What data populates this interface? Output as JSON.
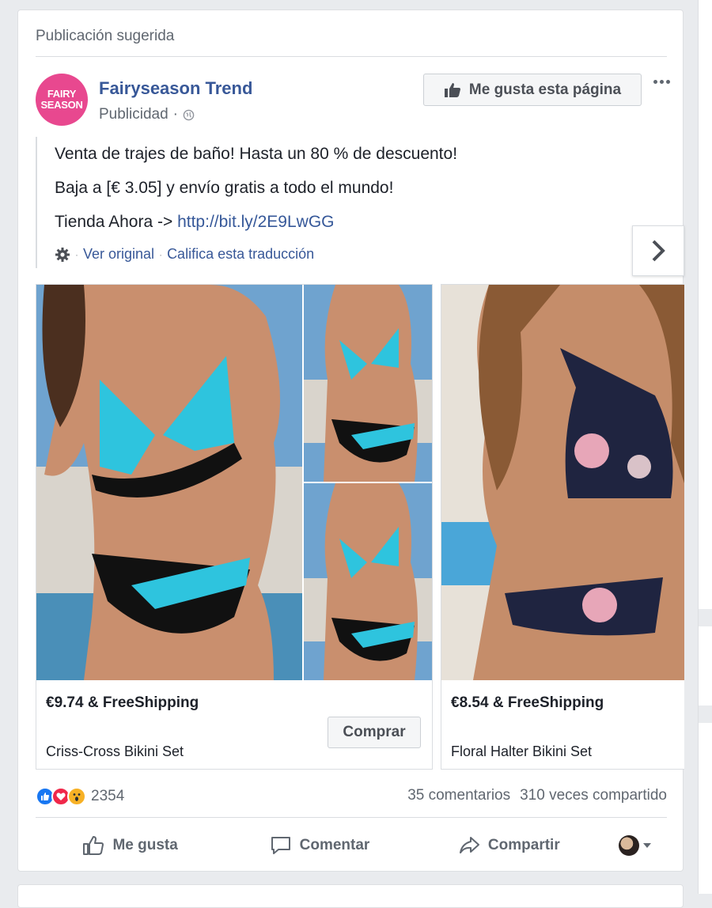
{
  "post": {
    "suggested_label": "Publicación sugerida",
    "page_name": "Fairyseason Trend",
    "avatar_text_line1": "FAIRY",
    "avatar_text_line2": "SEASON",
    "sponsored_label": "Publicidad",
    "separator": "·",
    "like_page_label": "Me gusta esta página",
    "text_line1": "Venta de trajes de baño! Hasta un 80 % de descuento!",
    "text_line2": "Baja a [€ 3.05] y envío gratis a todo el mundo!",
    "text_line3_prefix": "Tienda Ahora -> ",
    "text_line3_link": "http://bit.ly/2E9LwGG",
    "see_original": "Ver original",
    "rate_translation": "Califica esta traducción",
    "dot": "·"
  },
  "carousel": {
    "items": [
      {
        "price": "€9.74 & FreeShipping",
        "name": "Criss-Cross Bikini Set",
        "button": "Comprar"
      },
      {
        "price": "€8.54 & FreeShipping",
        "name": "Floral Halter Bikini Set"
      }
    ]
  },
  "engagement": {
    "reaction_count": "2354",
    "comments": "35 comentarios",
    "shares": "310 veces compartido"
  },
  "actions": {
    "like": "Me gusta",
    "comment": "Comentar",
    "share": "Compartir"
  },
  "colors": {
    "link": "#385898",
    "avatar_bg": "#e8488f",
    "swim_cyan": "#2ec4de"
  },
  "icons": [
    "globe-icon",
    "thumbs-up-icon",
    "more-icon",
    "gear-icon",
    "chevron-right-icon",
    "like-reaction-icon",
    "love-reaction-icon",
    "wow-reaction-icon",
    "comment-icon",
    "share-icon",
    "caret-down-icon"
  ]
}
